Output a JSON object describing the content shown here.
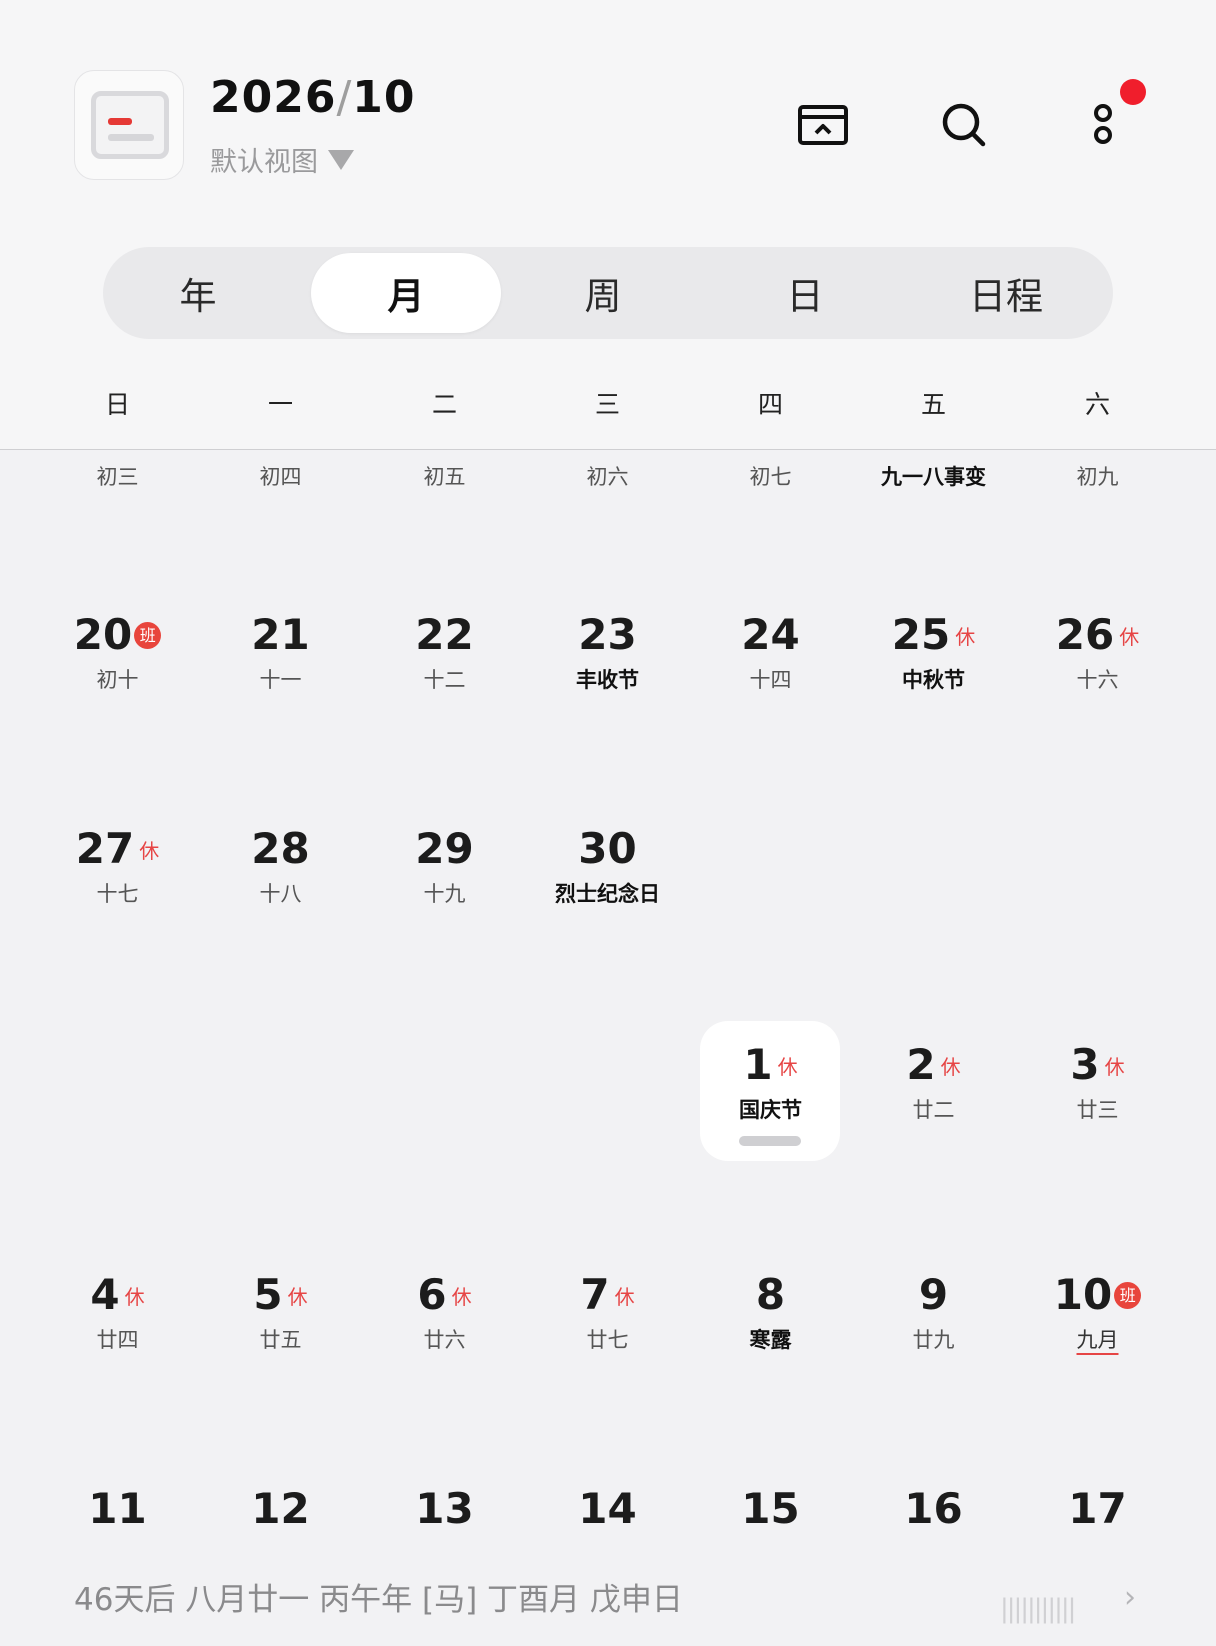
{
  "header": {
    "title_year": "2026",
    "title_slash": "/",
    "title_month": "10",
    "view_label": "默认视图"
  },
  "tabs": [
    {
      "label": "年"
    },
    {
      "label": "月",
      "active": true
    },
    {
      "label": "周"
    },
    {
      "label": "日"
    },
    {
      "label": "日程"
    }
  ],
  "weekdays": [
    "日",
    "一",
    "二",
    "三",
    "四",
    "五",
    "六"
  ],
  "colors": {
    "accent_red": "#e64545",
    "notify_dot": "#f01e2c"
  },
  "rows": [
    [
      {
        "day": "",
        "lunar": "初三"
      },
      {
        "day": "",
        "lunar": "初四"
      },
      {
        "day": "",
        "lunar": "初五"
      },
      {
        "day": "",
        "lunar": "初六"
      },
      {
        "day": "",
        "lunar": "初七"
      },
      {
        "day": "",
        "lunar": "九一八事变"
      },
      {
        "day": "",
        "lunar": "初九"
      }
    ],
    [
      {
        "day": "20",
        "tag": "班",
        "lunar": "初十"
      },
      {
        "day": "21",
        "lunar": "十一"
      },
      {
        "day": "22",
        "lunar": "十二"
      },
      {
        "day": "23",
        "lunar": "丰收节"
      },
      {
        "day": "24",
        "lunar": "十四"
      },
      {
        "day": "25",
        "tag": "休",
        "lunar": "中秋节"
      },
      {
        "day": "26",
        "tag": "休",
        "lunar": "十六"
      }
    ],
    [
      {
        "day": "27",
        "tag": "休",
        "lunar": "十七"
      },
      {
        "day": "28",
        "lunar": "十八"
      },
      {
        "day": "29",
        "lunar": "十九"
      },
      {
        "day": "30",
        "lunar": "烈士纪念日"
      }
    ],
    [
      {
        "day": "1",
        "tag": "休",
        "lunar": "国庆节"
      },
      {
        "day": "2",
        "tag": "休",
        "lunar": "廿二"
      },
      {
        "day": "3",
        "tag": "休",
        "lunar": "廿三"
      }
    ],
    [
      {
        "day": "4",
        "tag": "休",
        "lunar": "廿四"
      },
      {
        "day": "5",
        "tag": "休",
        "lunar": "廿五"
      },
      {
        "day": "6",
        "tag": "休",
        "lunar": "廿六"
      },
      {
        "day": "7",
        "tag": "休",
        "lunar": "廿七"
      },
      {
        "day": "8",
        "lunar": "寒露"
      },
      {
        "day": "9",
        "lunar": "廿九"
      },
      {
        "day": "10",
        "tag": "班",
        "lunar": "九月"
      }
    ],
    [
      {
        "day": "11"
      },
      {
        "day": "12"
      },
      {
        "day": "13"
      },
      {
        "day": "14"
      },
      {
        "day": "15"
      },
      {
        "day": "16"
      },
      {
        "day": "17"
      }
    ]
  ],
  "footer": {
    "text": "46天后 八月廿一 丙午年 [马] 丁酉月 戊申日"
  }
}
